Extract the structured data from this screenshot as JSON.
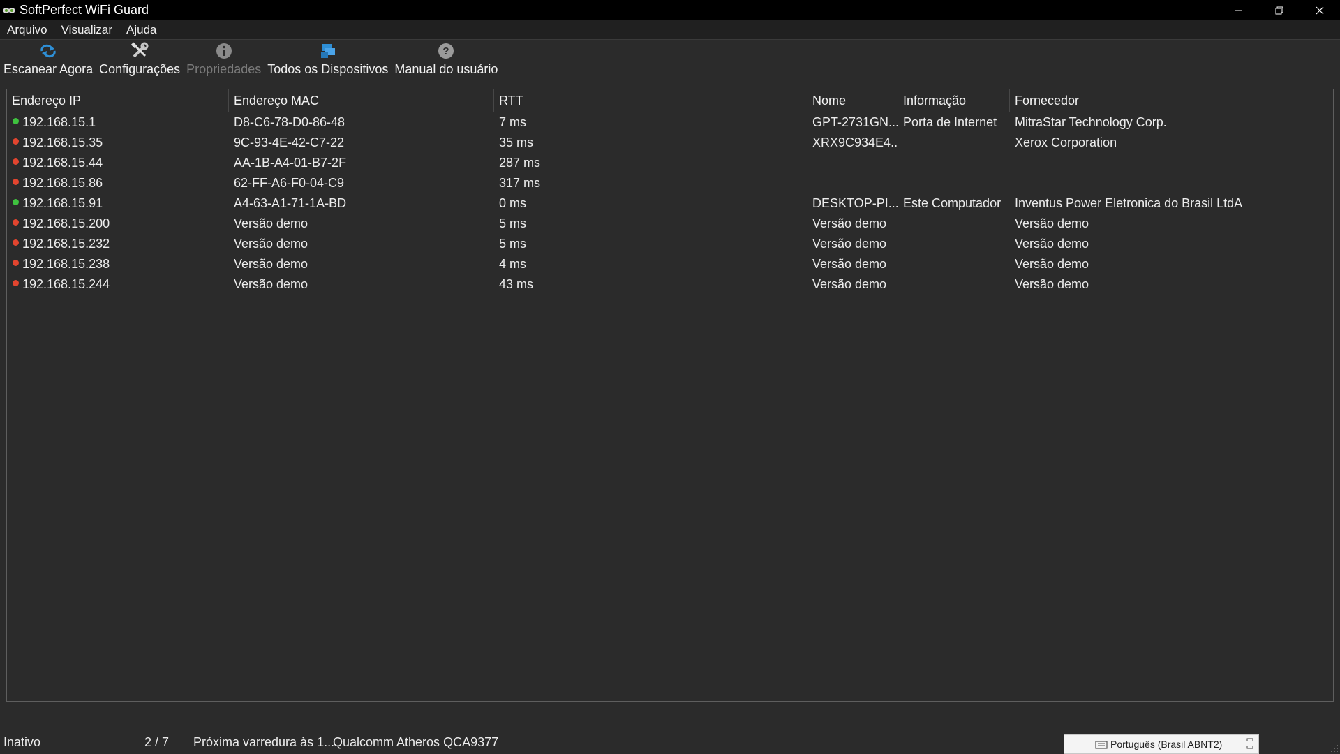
{
  "window": {
    "title": "SoftPerfect WiFi Guard",
    "controls": {
      "minimize": "—",
      "restore": "❐",
      "close": "✕"
    }
  },
  "menu": [
    "Arquivo",
    "Visualizar",
    "Ajuda"
  ],
  "toolbar": [
    {
      "label": "Escanear Agora",
      "icon": "refresh-icon",
      "enabled": true
    },
    {
      "label": "Configurações",
      "icon": "tools-icon",
      "enabled": true
    },
    {
      "label": "Propriedades",
      "icon": "info-icon",
      "enabled": false
    },
    {
      "label": "Todos os Dispositivos",
      "icon": "devices-icon",
      "enabled": true
    },
    {
      "label": "Manual do usuário",
      "icon": "help-icon",
      "enabled": true
    }
  ],
  "table": {
    "columns": [
      "Endereço IP",
      "Endereço MAC",
      "RTT",
      "Nome",
      "Informação",
      "Fornecedor",
      ""
    ],
    "rows": [
      {
        "status": "green",
        "ip": "192.168.15.1",
        "mac": "D8-C6-78-D0-86-48",
        "rtt": "7 ms",
        "name": "GPT-2731GN...",
        "info": "Porta de Internet",
        "vendor": "MitraStar Technology Corp."
      },
      {
        "status": "red",
        "ip": "192.168.15.35",
        "mac": "9C-93-4E-42-C7-22",
        "rtt": "35 ms",
        "name": "XRX9C934E4...",
        "info": "",
        "vendor": "Xerox Corporation"
      },
      {
        "status": "red",
        "ip": "192.168.15.44",
        "mac": "AA-1B-A4-01-B7-2F",
        "rtt": "287 ms",
        "name": "",
        "info": "",
        "vendor": ""
      },
      {
        "status": "red",
        "ip": "192.168.15.86",
        "mac": "62-FF-A6-F0-04-C9",
        "rtt": "317 ms",
        "name": "",
        "info": "",
        "vendor": ""
      },
      {
        "status": "green",
        "ip": "192.168.15.91",
        "mac": "A4-63-A1-71-1A-BD",
        "rtt": "0 ms",
        "name": "DESKTOP-PI...",
        "info": "Este Computador",
        "vendor": "Inventus Power Eletronica do Brasil LtdA"
      },
      {
        "status": "red",
        "ip": "192.168.15.200",
        "mac": "Versão demo",
        "rtt": "5 ms",
        "name": "Versão demo",
        "info": "",
        "vendor": "Versão demo"
      },
      {
        "status": "red",
        "ip": "192.168.15.232",
        "mac": "Versão demo",
        "rtt": "5 ms",
        "name": "Versão demo",
        "info": "",
        "vendor": "Versão demo"
      },
      {
        "status": "red",
        "ip": "192.168.15.238",
        "mac": "Versão demo",
        "rtt": "4 ms",
        "name": "Versão demo",
        "info": "",
        "vendor": "Versão demo"
      },
      {
        "status": "red",
        "ip": "192.168.15.244",
        "mac": "Versão demo",
        "rtt": "43 ms",
        "name": "Versão demo",
        "info": "",
        "vendor": "Versão demo"
      }
    ]
  },
  "statusbar": {
    "state": "Inativo",
    "count": "2 / 7",
    "next_scan": "Próxima varredura às 1...",
    "adapter": "Qualcomm Atheros QCA9377",
    "language": "Português (Brasil ABNT2)"
  },
  "colors": {
    "status_green": "#3fc23f",
    "status_red": "#e2452f",
    "accent_blue": "#2e8fd6"
  }
}
